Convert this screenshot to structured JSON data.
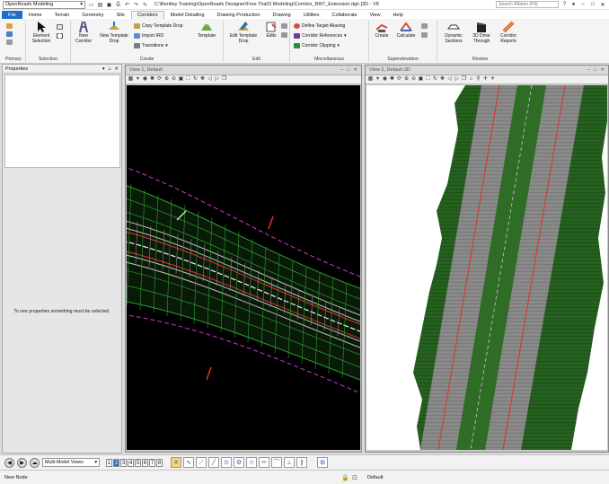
{
  "titlebar": {
    "workflow": "OpenRoads Modeling",
    "title": "C:\\Bentley Training\\OpenRoads Designer\\Free Trial\\3 Modeling\\Corridor_Rt97_Extension.dgn [3D - V8",
    "search_placeholder": "Search Ribbon (F4)"
  },
  "tabs": [
    "File",
    "Home",
    "Terrain",
    "Geometry",
    "Site",
    "Corridors",
    "Model Detailing",
    "Drawing Production",
    "Drawing",
    "Utilities",
    "Collaborate",
    "View",
    "Help"
  ],
  "ribbon": {
    "primary": {
      "label": "Primary"
    },
    "selection": {
      "label": "Selection",
      "element_selection": "Element Selection"
    },
    "create": {
      "label": "Create",
      "new_corridor": "New Corridor",
      "new_template_drop": "New Template Drop",
      "copy_template_drop": "Copy Template Drop",
      "import_ird": "Import IRD",
      "transitions": "Transitions",
      "template": "Template"
    },
    "edit": {
      "label": "Edit",
      "edit_template_drop": "Edit Template Drop",
      "edits": "Edits"
    },
    "misc": {
      "label": "Miscellaneous",
      "define_target_aliasing": "Define Target Aliasing",
      "corridor_references": "Corridor References",
      "corridor_clipping": "Corridor Clipping"
    },
    "super": {
      "label": "Superelevation",
      "create": "Create",
      "calculate": "Calculate"
    },
    "review": {
      "label": "Review",
      "dynamic_sections": "Dynamic Sections",
      "drive_through": "3D Drive Through",
      "corridor_reports": "Corridor Reports"
    }
  },
  "properties": {
    "title": "Properties",
    "message": "To see properties something must be selected."
  },
  "views": [
    {
      "title": "View 1, Default"
    },
    {
      "title": "View 2, Default-3D"
    }
  ],
  "statusbar": {
    "multi_model_views": "Multi-Model Views",
    "view_numbers": [
      "1",
      "2",
      "3",
      "4",
      "5",
      "6",
      "7",
      "8"
    ],
    "active_view": "1",
    "status": "New Node",
    "level": "Default"
  },
  "colors": {
    "accent": "#1c6fc6",
    "road_green": "#26601f",
    "lane_gray": "#8a8a8a",
    "center_red": "#e0302a",
    "edge_magenta": "#d236d2"
  }
}
